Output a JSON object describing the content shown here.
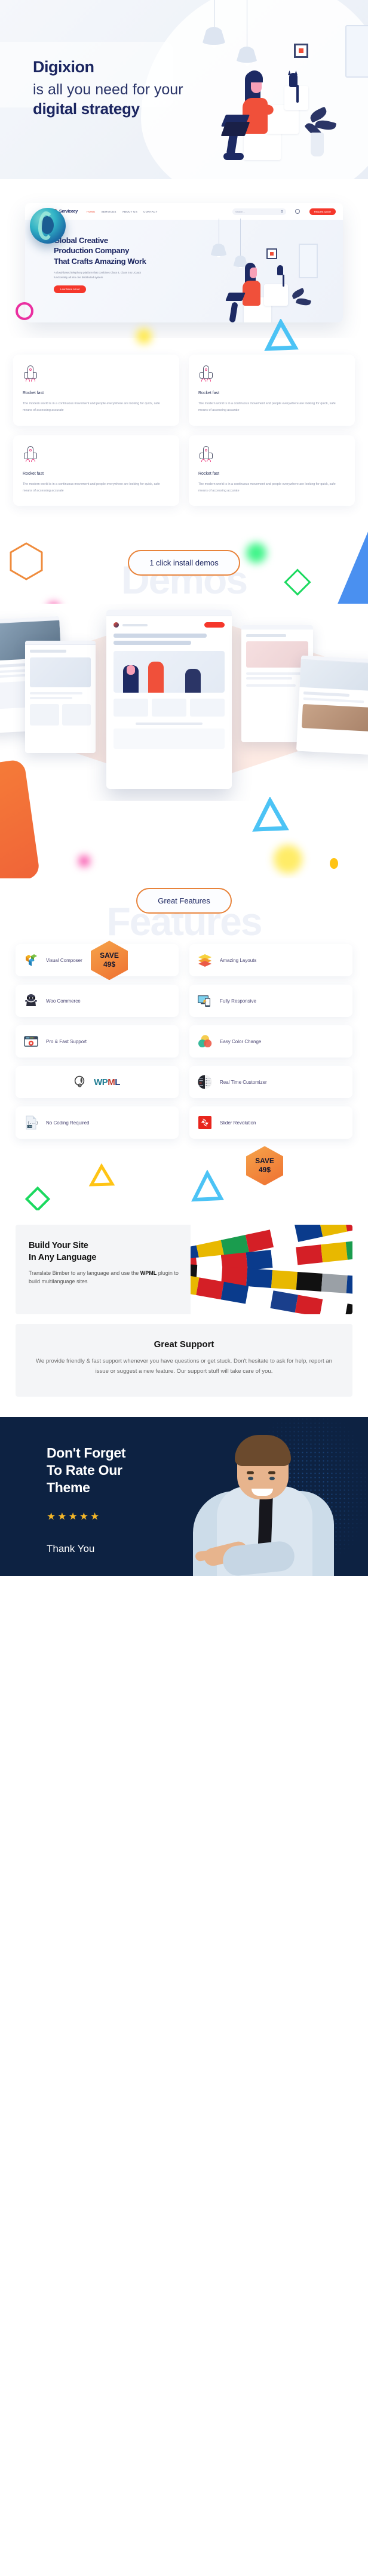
{
  "hero": {
    "brand": "Digixion",
    "line2": "is all you need for your",
    "line3": "digital strategy"
  },
  "browser_mock": {
    "logo_text": "Serviceey",
    "nav": [
      {
        "label": "HOME",
        "active": true
      },
      {
        "label": "SERVICES",
        "active": false
      },
      {
        "label": "ABOUT US",
        "active": false
      },
      {
        "label": "CONTACT",
        "active": false
      }
    ],
    "search_placeholder": "Search...",
    "header_button": "Request Quote",
    "headline_line1": "Global Creative",
    "headline_line2": "Production Company",
    "headline_line3": "That Crafts Amazing Work",
    "paragraph": "A cloud-based telephony platform that combines Class 4, Class 5 & UCaaS functionality all into one distributed system.",
    "cta": "Lear More About"
  },
  "rocket_cards": [
    {
      "icon": "rocket-icon",
      "title": "Rocket fast",
      "text": "The modern world is in a continuous movement and people everywhere are looking for quick, safe means of accessing accurate"
    },
    {
      "icon": "rocket-icon",
      "title": "Rocket fast",
      "text": "The modern world is in a continuous movement and people everywhere are looking for quick, safe means of accessing accurate"
    },
    {
      "icon": "rocket-icon",
      "title": "Rocket fast",
      "text": "The modern world is in a continuous movement and people everywhere are looking for quick, safe means of accessing accurate"
    },
    {
      "icon": "rocket-icon",
      "title": "Rocket fast",
      "text": "The modern world is in a continuous movement and people everywhere are looking for quick, safe means of accessing accurate"
    }
  ],
  "demos_section": {
    "pill_label": "1 click install demos",
    "ghost_word": "Demos"
  },
  "features_section": {
    "pill_label": "Great Features",
    "ghost_word": "Features",
    "badge_top": {
      "line1": "SAVE",
      "line2": "49$"
    },
    "badge_bottom": {
      "line1": "SAVE",
      "line2": "49$"
    },
    "items": [
      {
        "icon": "visual-composer-icon",
        "label": "Visual Composer"
      },
      {
        "icon": "layers-icon",
        "label": "Amazing Layouts"
      },
      {
        "icon": "woocommerce-ninja-icon",
        "label": "Woo Commerce"
      },
      {
        "icon": "responsive-devices-icon",
        "label": "Fully Responsive"
      },
      {
        "icon": "support-gear-icon",
        "label": "Pro & Fast Support"
      },
      {
        "icon": "color-circles-icon",
        "label": "Easy Color Change"
      },
      {
        "icon": "wpml-logo-icon",
        "label": "WPML"
      },
      {
        "icon": "customizer-panel-icon",
        "label": "Real Time Customizer"
      },
      {
        "icon": "css-file-icon",
        "label": "No Coding Required"
      },
      {
        "icon": "slider-revolution-icon",
        "label": "Slider Revolution"
      }
    ]
  },
  "wpml_panel": {
    "title_line1": "Build Your Site",
    "title_line2": "In Any Language",
    "text_before": "Translate Bimber to any language and use the ",
    "text_bold": "WPML",
    "text_after": " plugin to build multilanguage sites"
  },
  "support_panel": {
    "title": "Great Support",
    "text": "We provide friendly & fast support whenever you have questions or get stuck. Don't hesitate to ask for help, report an issue or suggest a new feature. Our support stuff will take care of you."
  },
  "footer": {
    "title_line1": "Don't Forget",
    "title_line2": "To Rate Our",
    "title_line3": "Theme",
    "stars": "★★★★★",
    "thanks": "Thank You"
  },
  "colors": {
    "navy": "#1b2560",
    "orange": "#e8833a",
    "red": "#f5372b",
    "footer_bg": "#0d2242",
    "star_gold": "#f5b728"
  }
}
